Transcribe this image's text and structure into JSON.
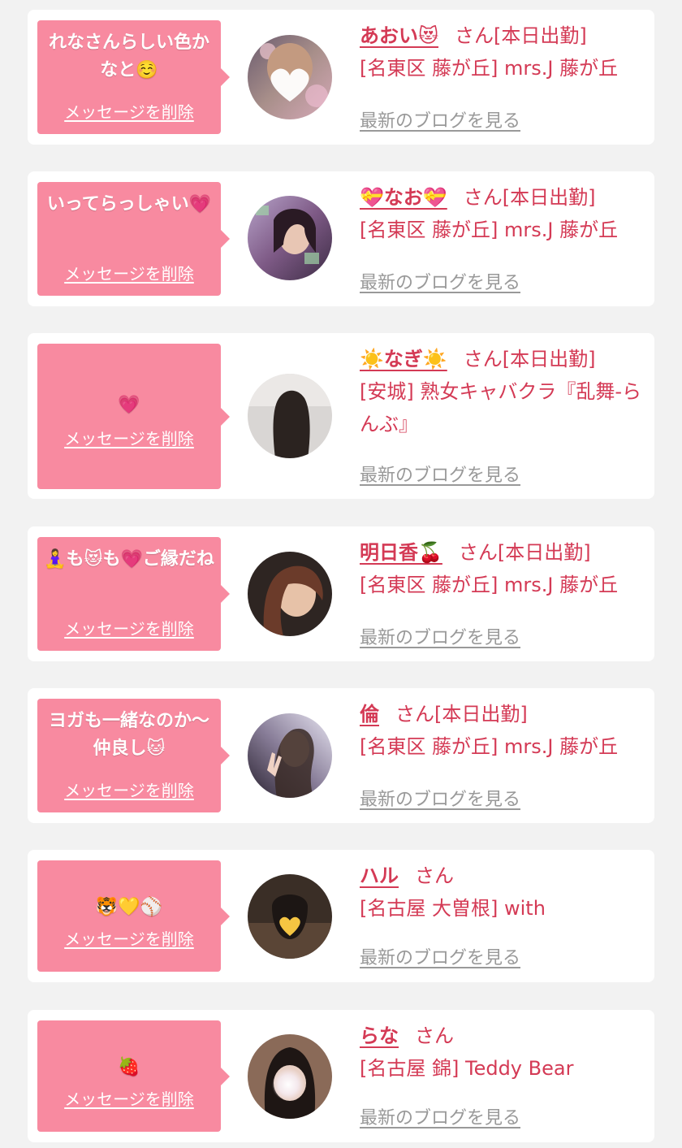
{
  "delete_label": "メッセージを削除",
  "blog_label": "最新のブログを見る",
  "honorific": "さん",
  "colors": {
    "page_bg": "#f2f2f2",
    "bubble": "#f88aa0",
    "accent": "#d43a55",
    "muted_link": "#999999"
  },
  "entries": [
    {
      "message": "れなさんらしい色かなと☺️",
      "name": "あおい😻",
      "status": "[本日出勤]",
      "shop": "[名東区 藤が丘] mrs.J 藤が丘",
      "avatar_icon": "profile-photo-heart-blur"
    },
    {
      "message": "いってらっしゃい💗",
      "name": "💝なお💝",
      "status": "[本日出勤]",
      "shop": "[名東区 藤が丘] mrs.J 藤が丘",
      "avatar_icon": "profile-photo"
    },
    {
      "message": "💗",
      "name": "☀️なぎ☀️",
      "status": "[本日出勤]",
      "shop": "[安城] 熟女キャバクラ『乱舞-らんぶ』",
      "avatar_icon": "profile-photo-back"
    },
    {
      "message": "🧘‍♀️も😻も💗ご縁だね",
      "name": "明日香🍒",
      "status": "[本日出勤]",
      "shop": "[名東区 藤が丘] mrs.J 藤が丘",
      "avatar_icon": "profile-photo"
    },
    {
      "message": "ヨガも一緒なのか〜仲良し🐱",
      "name": "倫",
      "status": "[本日出勤]",
      "shop": "[名東区 藤が丘] mrs.J 藤が丘",
      "avatar_icon": "profile-photo-peace"
    },
    {
      "message": "🐯💛⚾️",
      "name": "ハル",
      "status": "",
      "shop": "[名古屋 大曽根] with",
      "avatar_icon": "profile-photo-heart"
    },
    {
      "message": "🍓",
      "name": "らな",
      "status": "",
      "shop": "[名古屋 錦] Teddy Bear",
      "avatar_icon": "profile-photo-blur"
    }
  ]
}
